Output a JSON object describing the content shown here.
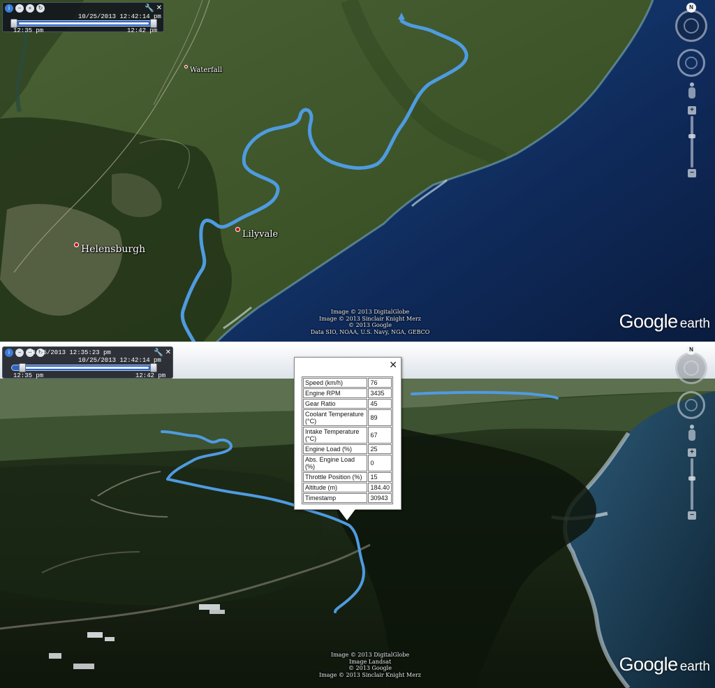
{
  "top_view": {
    "time_slider": {
      "current_time": "10/25/2013  12:42:14 pm",
      "range_start": "12:35 pm",
      "range_end": "12:42 pm"
    },
    "nav": {
      "north_label": "N"
    },
    "places": [
      {
        "name": "Waterfall"
      },
      {
        "name": "Lilyvale"
      },
      {
        "name": "Helensburgh"
      }
    ],
    "attribution": [
      "Image © 2013 DigitalGlobe",
      "Image © 2013 Sinclair Knight Merz",
      "© 2013 Google",
      "Data SIO, NOAA, U.S. Navy, NGA, GEBCO"
    ],
    "brand": {
      "google": "Google",
      "earth": "earth"
    }
  },
  "bottom_view": {
    "time_slider": {
      "begin_time": "10/25/2013  12:35:23 pm",
      "end_time": "10/25/2013  12:42:14 pm",
      "range_start": "12:35 pm",
      "range_end": "12:42 pm"
    },
    "nav": {
      "north_label": "N"
    },
    "balloon": {
      "close_label": "✕",
      "rows": [
        {
          "label": "Speed (km/h)",
          "value": "76"
        },
        {
          "label": "Engine RPM",
          "value": "3435"
        },
        {
          "label": "Gear Ratio",
          "value": "45"
        },
        {
          "label": "Coolant Temperature (°C)",
          "value": "89"
        },
        {
          "label": "Intake Temperature (°C)",
          "value": "67"
        },
        {
          "label": "Engine Load (%)",
          "value": "25"
        },
        {
          "label": "Abs. Engine Load (%)",
          "value": "0"
        },
        {
          "label": "Throttle Position (%)",
          "value": "15"
        },
        {
          "label": "Altitude (m)",
          "value": "184.40"
        },
        {
          "label": "Timestamp",
          "value": "30943"
        }
      ]
    },
    "attribution": [
      "Image © 2013 DigitalGlobe",
      "Image Landsat",
      "© 2013 Google",
      "Image © 2013 Sinclair Knight Merz"
    ],
    "brand": {
      "google": "Google",
      "earth": "earth"
    }
  },
  "colors": {
    "track": "#4f9be0",
    "ocean": "#0f2a5a",
    "land": "#3f5a2c",
    "forest_dark": "#1c2b16",
    "slider_track": "#2a64c8",
    "place_marker": "#c31212"
  },
  "icons": {
    "time_slider_buttons": [
      "info-icon",
      "zoom-out-icon",
      "zoom-in-icon",
      "refresh-icon"
    ],
    "settings": "wrench-icon",
    "close": "close-icon"
  }
}
